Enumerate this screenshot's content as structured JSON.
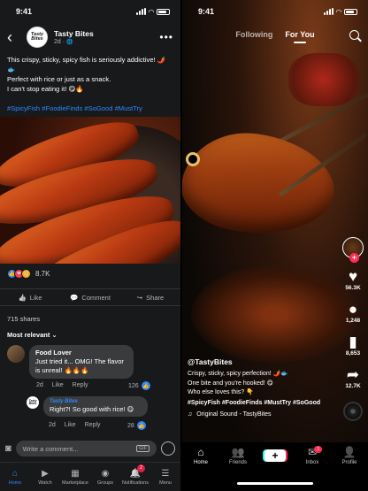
{
  "facebook": {
    "status": {
      "time": "9:41"
    },
    "header": {
      "back_glyph": "‹",
      "page_name": "Tasty Bites",
      "post_age": "2d · ",
      "globe_glyph": "🌐",
      "avatar_text": "Tasty Bites",
      "more_glyph": "•••"
    },
    "post": {
      "line1": "This crispy, sticky, spicy fish is seriously addictive! 🌶️🐟",
      "line2": "Perfect with rice or just as a snack.",
      "line3": "I can't stop eating it! 😋🔥",
      "hashtags": "#SpicyFish #FoodieFinds #SoGood #MustTry"
    },
    "reactions": {
      "count": "8.7K",
      "icons": [
        "👍",
        "❤",
        "😮"
      ]
    },
    "actions": [
      {
        "glyph": "👍",
        "label": "Like"
      },
      {
        "glyph": "💬",
        "label": "Comment"
      },
      {
        "glyph": "↪",
        "label": "Share"
      }
    ],
    "shares": "715 shares",
    "sort": "Most relevant ⌄",
    "comments": [
      {
        "name": "Food Lover",
        "text": "Just tried it... OMG! The flavor is unreal! 🔥🔥🔥",
        "age": "2d",
        "like": "Like",
        "reply": "Reply",
        "likes": "126"
      },
      {
        "name": "Tasty Bites",
        "text": "Right?! So good with rice! 😋",
        "age": "2d",
        "like": "Like",
        "reply": "Reply",
        "likes": "28",
        "avatar_text": "Tasty Bites"
      }
    ],
    "composer": {
      "placeholder": "Write a comment...",
      "gif": "GIF"
    },
    "nav": [
      {
        "glyph": "⌂",
        "label": "Home",
        "active": true
      },
      {
        "glyph": "▶",
        "label": "Watch"
      },
      {
        "glyph": "▦",
        "label": "Marketplace"
      },
      {
        "glyph": "◉",
        "label": "Groups"
      },
      {
        "glyph": "🔔",
        "label": "Notifications",
        "badge": "2"
      },
      {
        "glyph": "☰",
        "label": "Menu"
      }
    ],
    "colors": {
      "bg": "#18191a",
      "accent": "#2d88ff"
    }
  },
  "tiktok": {
    "status": {
      "time": "9:41"
    },
    "tabs": {
      "following": "Following",
      "for_you": "For You"
    },
    "rail": {
      "likes": "56.3K",
      "comments": "1,248",
      "saves": "8,653",
      "shares": "12.7K",
      "plus": "+"
    },
    "info": {
      "username": "@TastyBites",
      "caption1": "Crispy, sticky, spicy perfection! 🌶️🐟",
      "caption2": "One bite and you're hooked! 😋",
      "caption3": "Who else loves this? 👇",
      "hashtags": "#SpicyFish #FoodieFinds #MustTry #SoGood",
      "sound": "Original Sound - TastyBites",
      "sound_glyph": "♫"
    },
    "nav": [
      {
        "glyph": "⌂",
        "label": "Home",
        "active": true
      },
      {
        "glyph": "👥",
        "label": "Friends"
      },
      {
        "glyph": "+",
        "label": ""
      },
      {
        "glyph": "✉",
        "label": "Inbox",
        "badge": "3"
      },
      {
        "glyph": "👤",
        "label": "Profile"
      }
    ],
    "colors": {
      "like": "#fe2c55",
      "cyan": "#25f4ee"
    }
  }
}
